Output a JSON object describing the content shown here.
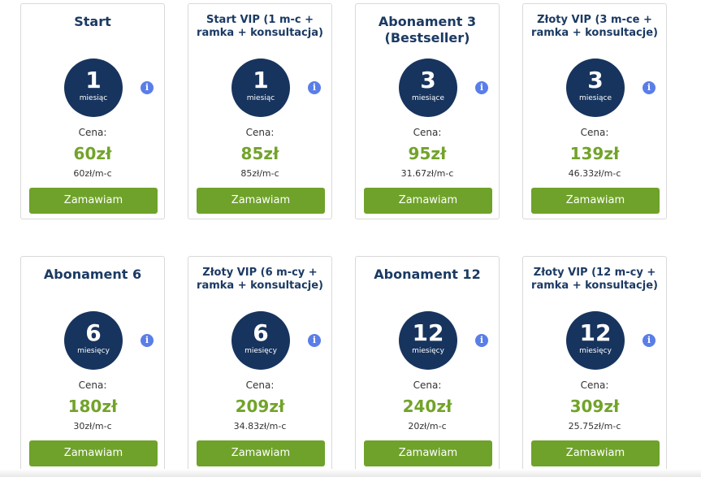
{
  "common": {
    "price_label": "Cena:",
    "order_label": "Zamawiam",
    "info_glyph": "i"
  },
  "colors": {
    "title": "#1b3a63",
    "circle": "#17345e",
    "price": "#72a32a",
    "button": "#6fa22a",
    "info": "#5a7ee8"
  },
  "plans": [
    {
      "title": "Start",
      "months": "1",
      "unit": "miesiąc",
      "price": "60zł",
      "per_month": "60zł/m-c"
    },
    {
      "title": "Start VIP (1 m-c + ramka + konsultacja)",
      "months": "1",
      "unit": "miesiąc",
      "price": "85zł",
      "per_month": "85zł/m-c"
    },
    {
      "title": "Abonament 3 (Bestseller)",
      "months": "3",
      "unit": "miesiące",
      "price": "95zł",
      "per_month": "31.67zł/m-c"
    },
    {
      "title": "Złoty VIP (3 m-ce + ramka + konsultacje)",
      "months": "3",
      "unit": "miesiące",
      "price": "139zł",
      "per_month": "46.33zł/m-c"
    },
    {
      "title": "Abonament 6",
      "months": "6",
      "unit": "miesięcy",
      "price": "180zł",
      "per_month": "30zł/m-c"
    },
    {
      "title": "Złoty VIP (6 m-cy + ramka + konsultacje)",
      "months": "6",
      "unit": "miesięcy",
      "price": "209zł",
      "per_month": "34.83zł/m-c"
    },
    {
      "title": "Abonament 12",
      "months": "12",
      "unit": "miesięcy",
      "price": "240zł",
      "per_month": "20zł/m-c"
    },
    {
      "title": "Złoty VIP (12 m-cy + ramka + konsultacje)",
      "months": "12",
      "unit": "miesięcy",
      "price": "309zł",
      "per_month": "25.75zł/m-c"
    }
  ]
}
